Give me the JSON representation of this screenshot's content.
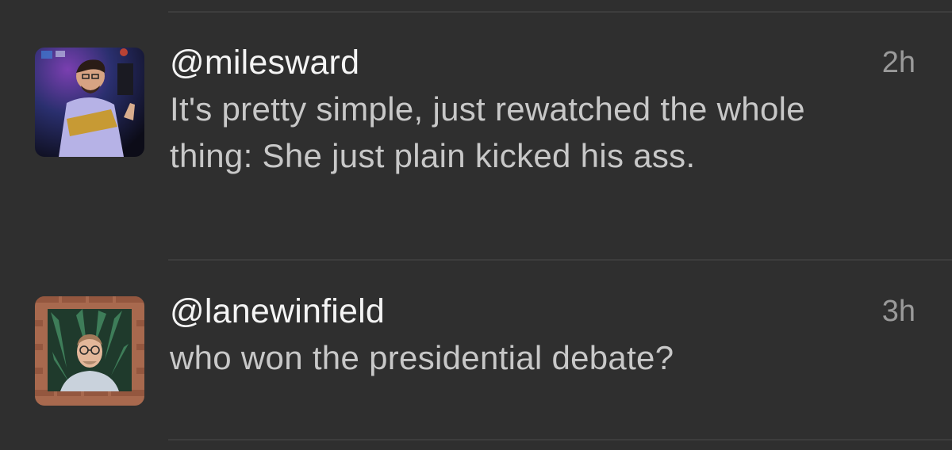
{
  "timeline": {
    "tweets": [
      {
        "handle": "@milesward",
        "time": "2h",
        "text": "It's pretty simple, just rewatched the whole thing: She just plain kicked his ass.",
        "avatar_icon": "musician-photo-avatar"
      },
      {
        "handle": "@lanewinfield",
        "time": "3h",
        "text": "who won the presidential debate?",
        "avatar_icon": "man-with-glasses-photo-avatar"
      }
    ]
  },
  "colors": {
    "background": "#2f2f2f",
    "divider": "#3d3d3d",
    "handle": "#f4f4f4",
    "body_text": "#c8c8c8",
    "timestamp": "#9a9a9a"
  }
}
